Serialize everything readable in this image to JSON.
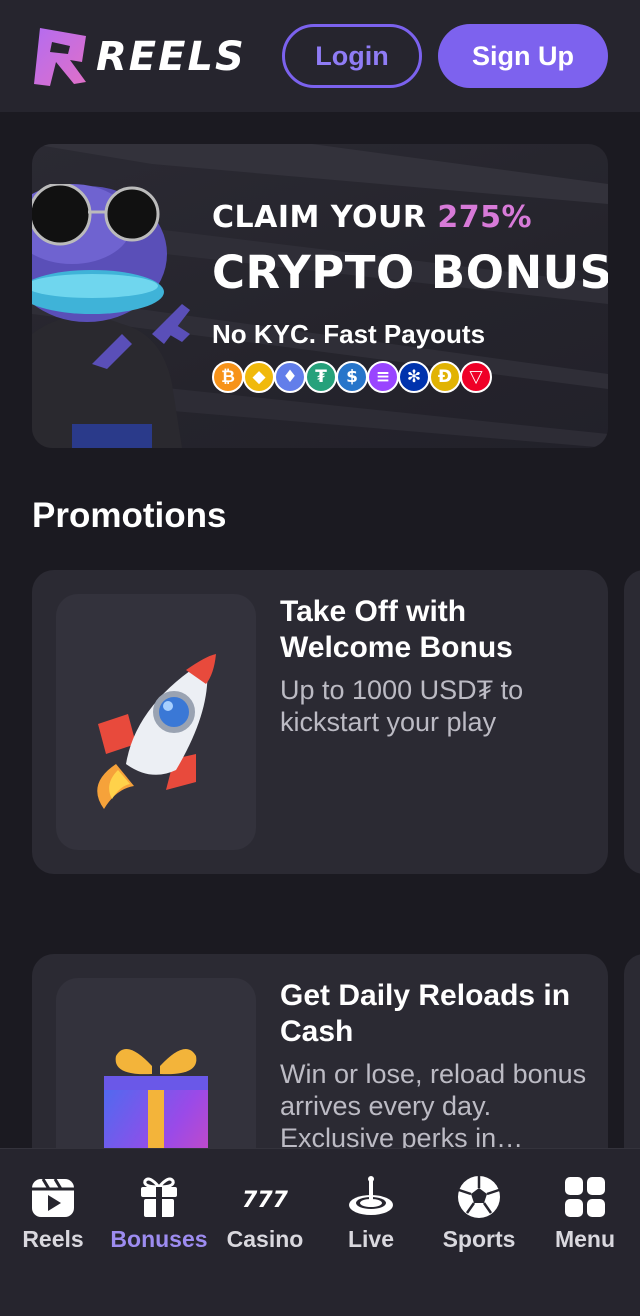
{
  "header": {
    "logo_text": "REELS",
    "login_label": "Login",
    "signup_label": "Sign Up"
  },
  "banner": {
    "claim_text": "CLAIM YOUR",
    "claim_percent": "275%",
    "headline": "CRYPTO BONUS",
    "subline": "No KYC. Fast Payouts",
    "coins": [
      {
        "icon": "bitcoin-icon",
        "glyph": "₿",
        "color": "#f7931a"
      },
      {
        "icon": "bnb-icon",
        "glyph": "◆",
        "color": "#f0b90b"
      },
      {
        "icon": "ethereum-icon",
        "glyph": "♦",
        "color": "#627eea"
      },
      {
        "icon": "tether-icon",
        "glyph": "₮",
        "color": "#26a17b"
      },
      {
        "icon": "usdc-icon",
        "glyph": "$",
        "color": "#2775ca"
      },
      {
        "icon": "solana-icon",
        "glyph": "≡",
        "color": "#9945ff"
      },
      {
        "icon": "cardano-icon",
        "glyph": "✻",
        "color": "#0033ad"
      },
      {
        "icon": "dogecoin-icon",
        "glyph": "Ð",
        "color": "#e1b303"
      },
      {
        "icon": "tron-icon",
        "glyph": "▽",
        "color": "#ef0027"
      }
    ]
  },
  "promotions": {
    "title": "Promotions",
    "cards": [
      {
        "title": "Take Off with Welcome Bonus",
        "description": "Up to 1000 USD₮ to kickstart your play",
        "icon": "rocket-icon"
      },
      {
        "title": "Get Daily Reloads in Cash",
        "description": "Win or lose, reload bonus arrives every day. Exclusive perks in…",
        "icon": "gift-icon"
      }
    ]
  },
  "nav": {
    "items": [
      {
        "label": "Reels",
        "icon": "reels-icon",
        "active": false
      },
      {
        "label": "Bonuses",
        "icon": "gift-icon",
        "active": true
      },
      {
        "label": "Casino",
        "icon": "slots-777-icon",
        "active": false
      },
      {
        "label": "Live",
        "icon": "roulette-icon",
        "active": false
      },
      {
        "label": "Sports",
        "icon": "soccer-ball-icon",
        "active": false
      },
      {
        "label": "Menu",
        "icon": "grid-menu-icon",
        "active": false
      }
    ]
  },
  "colors": {
    "accent": "#7d62ee",
    "accent_text": "#9d8cf0",
    "background": "#1b1a21",
    "card": "#2b2a33",
    "claim_percent": "#d77ad8"
  }
}
